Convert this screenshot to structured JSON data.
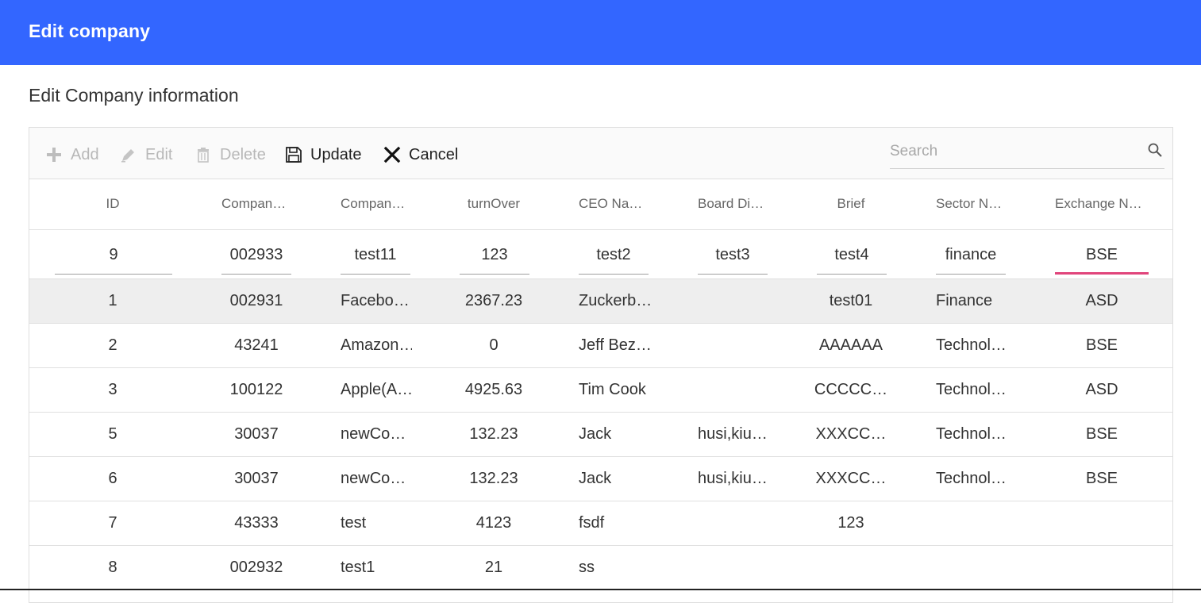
{
  "header": {
    "title": "Edit company"
  },
  "subtitle": "Edit Company information",
  "toolbar": {
    "add": "Add",
    "edit": "Edit",
    "delete": "Delete",
    "update": "Update",
    "cancel": "Cancel",
    "search_placeholder": "Search"
  },
  "columns": [
    "ID",
    "Compan…",
    "Compan…",
    "turnOver",
    "CEO Na…",
    "Board Di…",
    "Brief",
    "Sector N…",
    "Exchange N…"
  ],
  "edit_row": {
    "id": "9",
    "code": "002933",
    "name": "test11",
    "turnover": "123",
    "ceo": "test2",
    "board": "test3",
    "brief": "test4",
    "sector": "finance",
    "exchange": "BSE"
  },
  "rows": [
    [
      "1",
      "002931",
      "Facebo…",
      "2367.23",
      "Zuckerb…",
      "",
      "test01",
      "Finance",
      "ASD"
    ],
    [
      "2",
      "43241",
      "Amazon…",
      "0",
      "Jeff Bez…",
      "",
      "AAAAAA",
      "Technol…",
      "BSE"
    ],
    [
      "3",
      "100122",
      "Apple(A…",
      "4925.63",
      "Tim Cook",
      "",
      "CCCCC…",
      "Technol…",
      "ASD"
    ],
    [
      "5",
      "30037",
      "newCo…",
      "132.23",
      "Jack",
      "husi,kiu…",
      "XXXCC…",
      "Technol…",
      "BSE"
    ],
    [
      "6",
      "30037",
      "newCo…",
      "132.23",
      "Jack",
      "husi,kiu…",
      "XXXCC…",
      "Technol…",
      "BSE"
    ],
    [
      "7",
      "43333",
      "test",
      "4123",
      "fsdf",
      "",
      "123",
      "",
      ""
    ],
    [
      "8",
      "002932",
      "test1",
      "21",
      "ss",
      "",
      "",
      "",
      ""
    ]
  ],
  "colors": {
    "header_bg": "#3366ff",
    "focus_underline": "#e0457b",
    "selected_row": "#eeeeee"
  }
}
